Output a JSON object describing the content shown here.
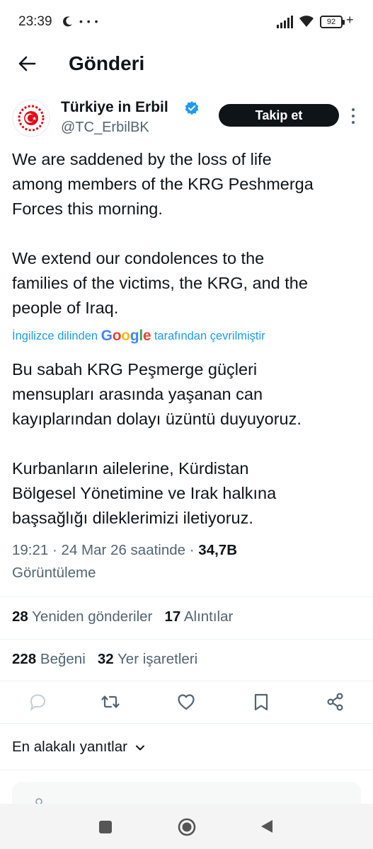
{
  "status_bar": {
    "time": "23:39",
    "dots": "• • •",
    "battery": "92",
    "icons": [
      "moon-icon",
      "signal-icon",
      "wifi-icon",
      "battery-icon",
      "charging-plus-icon"
    ]
  },
  "header": {
    "title": "Gönderi",
    "back_icon": "arrow-left-icon"
  },
  "author": {
    "name": "Türkiye in Erbil",
    "handle": "@TC_ErbilBK",
    "verified_icon": "verified-badge-icon",
    "follow_label": "Takip et",
    "more_icon": "more-vertical-icon"
  },
  "post": {
    "original_text": "We are saddened by the loss of life\namong members of the KRG Peshmerga\nForces this morning.\n\nWe extend our condolences to the\nfamilies of the victims, the KRG, and the\npeople of Iraq.",
    "translate_prefix": "İngilizce dilinden",
    "translate_brand": "Google",
    "translate_suffix": "tarafından çevrilmiştir",
    "translated_text": "Bu sabah KRG Peşmerge güçleri\nmensupları arasında yaşanan can\nkayıplarından dolayı üzüntü duyuyoruz.\n\nKurbanların ailelerine, Kürdistan\nBölgesel Yönetimine ve Irak halkına\nbaşsağlığı dileklerimizi iletiyoruz."
  },
  "meta": {
    "time": "19:21",
    "date": "24 Mar 26 saatinde",
    "separator": "·",
    "views_count": "34,7B",
    "views_label": "Görüntüleme"
  },
  "stats": {
    "reposts_count": "28",
    "reposts_label": "Yeniden gönderiler",
    "quotes_count": "17",
    "quotes_label": "Alıntılar",
    "likes_count": "228",
    "likes_label": "Beğeni",
    "bookmarks_count": "32",
    "bookmarks_label": "Yer işaretleri"
  },
  "actions": [
    "reply-icon",
    "repost-icon",
    "like-icon",
    "bookmark-icon",
    "share-icon"
  ],
  "replies": {
    "sort_label": "En alakalı yanıtlar",
    "sort_icon": "chevron-down-icon"
  },
  "colors": {
    "text": "#0f1419",
    "secondary": "#536471",
    "link": "#1d9bf0",
    "flag_red": "#e30a17",
    "verified": "#1d9bf0"
  }
}
